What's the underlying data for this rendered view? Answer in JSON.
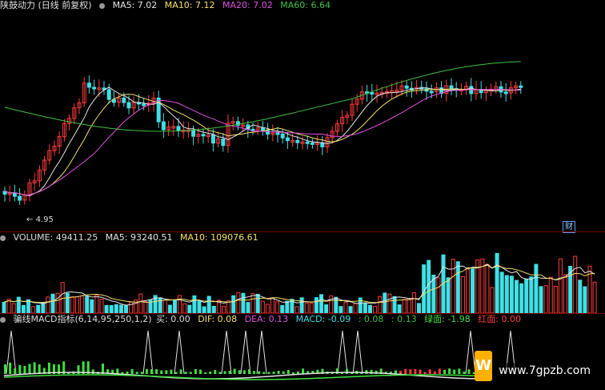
{
  "header": {
    "title": "陕鼓动力 (日线 前复权)",
    "ma5": "MA5: 7.02",
    "ma10": "MA10: 7.12",
    "ma20": "MA20: 7.02",
    "ma60": "MA60: 6.64"
  },
  "annotations": {
    "low_price": "4.95",
    "fin_label": "财"
  },
  "volume_header": {
    "label": "VOLUME: 49411.25",
    "ma5": "MA5: 93240.51",
    "ma10": "MA10: 109076.61"
  },
  "indicator_header": {
    "name": "骗线MACD指标(6,14,95,250,1,2)",
    "buy": "买: 0.00",
    "dif": "DIF: 0.08",
    "dea": "DEA: 0.13",
    "macd": "MACD: -0.09",
    "v1": ": 0.08",
    "v2": ": 0.13",
    "green": "绿面: -1.98",
    "red": "红面: 0.00"
  },
  "watermark": "www.7gpzb.com",
  "colors": {
    "up": "#ff3b3b",
    "down": "#3fe0e6",
    "ma5": "#e6e6e6",
    "ma10": "#f5e066",
    "ma20": "#e050e0",
    "ma60": "#40c040"
  }
}
